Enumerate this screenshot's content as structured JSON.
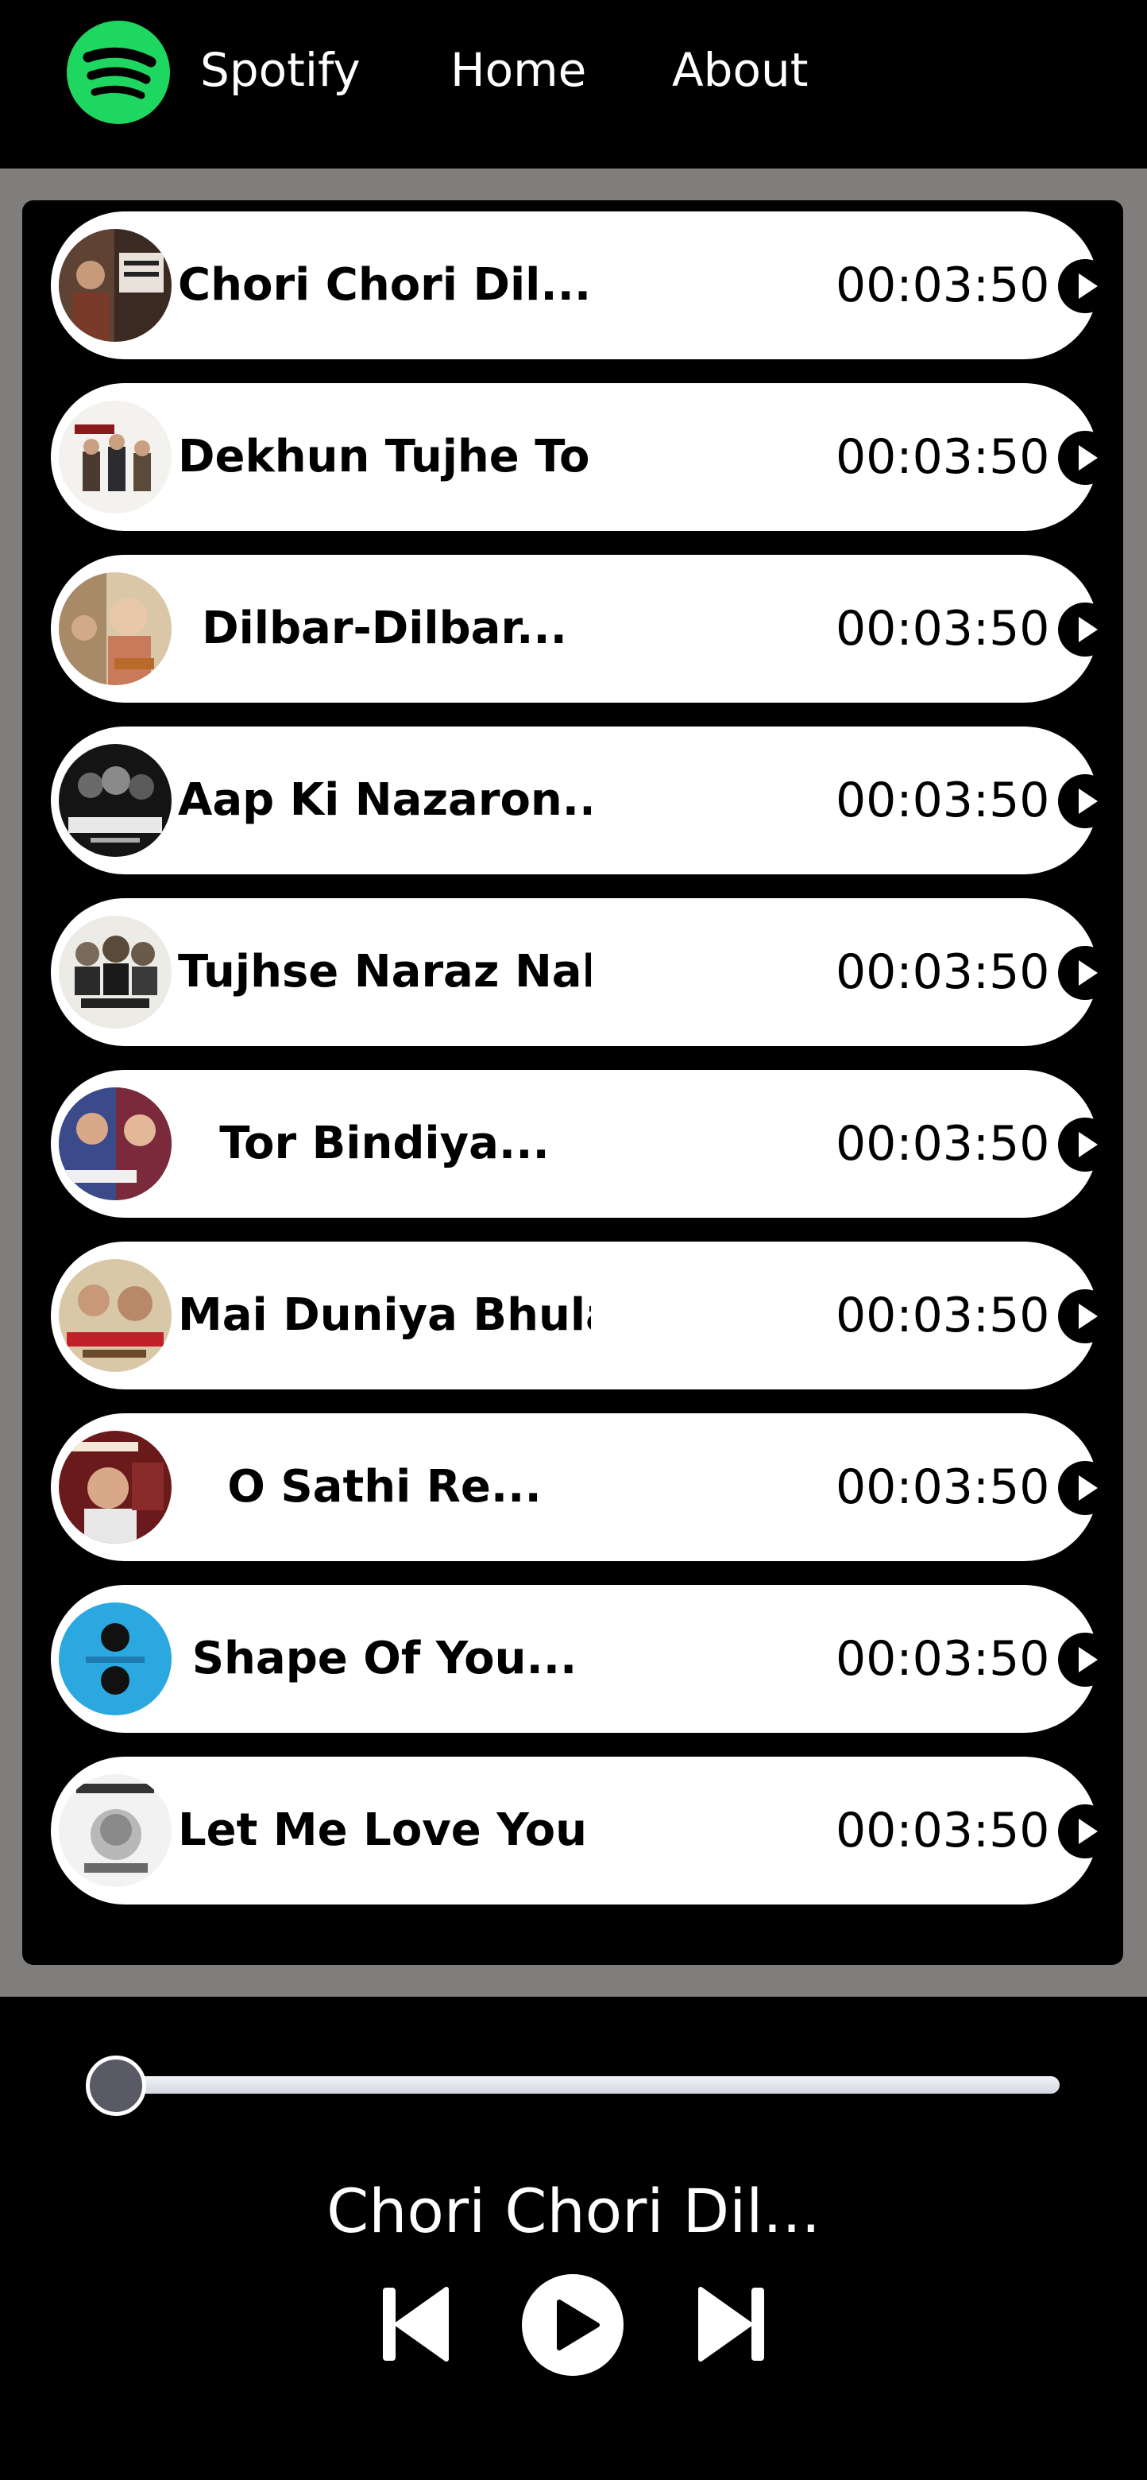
{
  "nav": {
    "brand": "Spotify",
    "logo_icon": "spotify-logo-icon",
    "items": [
      {
        "label": "Home"
      },
      {
        "label": "About"
      }
    ]
  },
  "colors": {
    "brand_green": "#1ed760",
    "list_background": "#807d7d",
    "panel": "#000000",
    "card": "#ffffff"
  },
  "songs": [
    {
      "title": "Chori Chori Dil...",
      "duration": "00:03:50",
      "cover_icon": "album-cover-icon"
    },
    {
      "title": "Dekhun Tujhe Toh...",
      "duration": "00:03:50",
      "cover_icon": "album-cover-icon"
    },
    {
      "title": "Dilbar-Dilbar...",
      "duration": "00:03:50",
      "cover_icon": "album-cover-icon"
    },
    {
      "title": "Aap Ki Nazaron...",
      "duration": "00:03:50",
      "cover_icon": "album-cover-icon"
    },
    {
      "title": "Tujhse Naraz Nahi...",
      "duration": "00:03:50",
      "cover_icon": "album-cover-icon"
    },
    {
      "title": "Tor Bindiya...",
      "duration": "00:03:50",
      "cover_icon": "album-cover-icon"
    },
    {
      "title": "Mai Duniya Bhula...",
      "duration": "00:03:50",
      "cover_icon": "album-cover-icon"
    },
    {
      "title": "O Sathi Re...",
      "duration": "00:03:50",
      "cover_icon": "album-cover-icon"
    },
    {
      "title": "Shape Of You...",
      "duration": "00:03:50",
      "cover_icon": "album-cover-icon"
    },
    {
      "title": "Let Me Love You...",
      "duration": "00:03:50",
      "cover_icon": "album-cover-icon"
    }
  ],
  "player": {
    "now_playing": "Chori Chori Dil...",
    "progress": 0,
    "controls": [
      "previous-icon",
      "play-icon",
      "next-icon"
    ]
  }
}
